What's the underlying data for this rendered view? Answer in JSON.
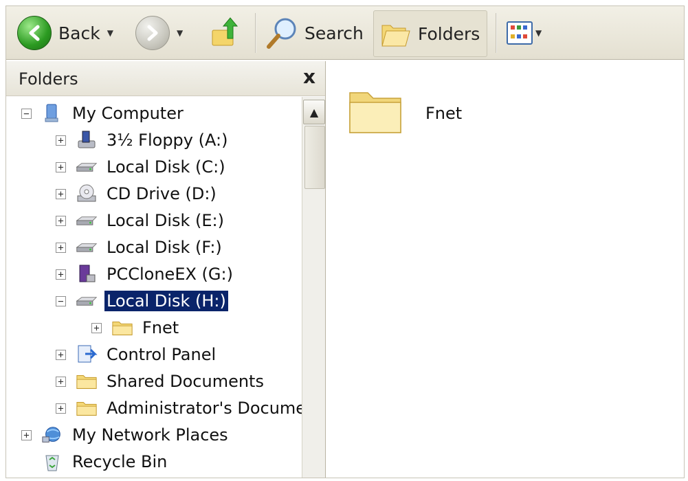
{
  "toolbar": {
    "back_label": "Back",
    "search_label": "Search",
    "folders_label": "Folders"
  },
  "folders_pane": {
    "title": "Folders",
    "close": "x"
  },
  "tree": [
    {
      "label": "My Computer",
      "expander": "−",
      "icon": "computer-icon"
    },
    {
      "label": "3½ Floppy (A:)",
      "expander": "+",
      "icon": "floppy-drive-icon"
    },
    {
      "label": "Local Disk (C:)",
      "expander": "+",
      "icon": "hard-disk-icon"
    },
    {
      "label": "CD Drive (D:)",
      "expander": "+",
      "icon": "cd-drive-icon"
    },
    {
      "label": "Local Disk (E:)",
      "expander": "+",
      "icon": "hard-disk-icon"
    },
    {
      "label": "Local Disk (F:)",
      "expander": "+",
      "icon": "hard-disk-icon"
    },
    {
      "label": "PCCloneEX (G:)",
      "expander": "+",
      "icon": "removable-drive-icon"
    },
    {
      "label": "Local Disk (H:)",
      "expander": "−",
      "icon": "hard-disk-icon",
      "selected": true
    },
    {
      "label": "Fnet",
      "expander": "+",
      "icon": "folder-icon"
    },
    {
      "label": "Control Panel",
      "expander": "+",
      "icon": "control-panel-icon"
    },
    {
      "label": "Shared Documents",
      "expander": "+",
      "icon": "folder-icon"
    },
    {
      "label": "Administrator's Documents",
      "expander": "+",
      "icon": "folder-icon"
    },
    {
      "label": "My Network Places",
      "expander": "+",
      "icon": "network-icon"
    },
    {
      "label": "Recycle Bin",
      "expander": "",
      "icon": "recycle-bin-icon"
    }
  ],
  "content": {
    "items": [
      {
        "name": "Fnet",
        "icon": "folder-icon"
      }
    ]
  },
  "colors": {
    "selection": "#0a246a",
    "folder": "#f7e39a",
    "toolbar": "#ebe8db"
  }
}
